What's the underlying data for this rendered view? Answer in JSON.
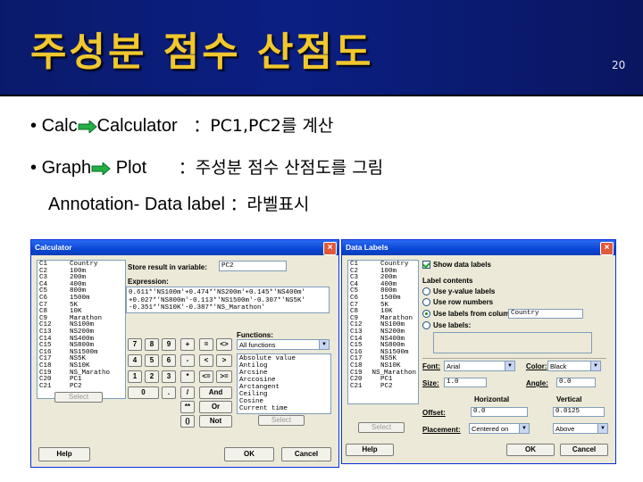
{
  "slide": {
    "title": "주성분 점수 산점도",
    "page_number": "20",
    "line1": {
      "bullet": "•",
      "a": "Calc",
      "b": "Calculator",
      "c": "：PC1,PC2를 계산"
    },
    "line2": {
      "bullet": "•",
      "a": "Graph",
      "b": "Plot",
      "c": "：주성분 점수 산점도를 그림"
    },
    "line3": {
      "a": "Annotation- Data label",
      "b": "：라벨표시"
    }
  },
  "calculator": {
    "title": "Calculator",
    "close": "×",
    "columns": [
      [
        "C1",
        "Country"
      ],
      [
        "C2",
        "100m"
      ],
      [
        "C3",
        "200m"
      ],
      [
        "C4",
        "400m"
      ],
      [
        "C5",
        "800m"
      ],
      [
        "C6",
        "1500m"
      ],
      [
        "C7",
        "5K"
      ],
      [
        "C8",
        "10K"
      ],
      [
        "C9",
        "Marathon"
      ],
      [
        "C12",
        "NS100m"
      ],
      [
        "C13",
        "NS200m"
      ],
      [
        "C14",
        "NS400m"
      ],
      [
        "C15",
        "NS800m"
      ],
      [
        "C16",
        "NS1500m"
      ],
      [
        "C17",
        "NS5K"
      ],
      [
        "C18",
        "NS10K"
      ],
      [
        "C19",
        "NS_Maratho"
      ],
      [
        "C20",
        "PC1"
      ],
      [
        "C21",
        "PC2"
      ]
    ],
    "store_label": "Store result in variable:",
    "store_value": "PC2",
    "expression_label": "Expression:",
    "expression_lines": [
      "0.611*'NS100m'+0.474*'NS200m'+0.145*'NS400m'",
      "+0.027*'NS800m'-0.113*'NS1500m'-0.307*'NS5K'",
      "-0.351*'NS10K'-0.387*'NS_Marathon'"
    ],
    "keypad": [
      [
        "7",
        "8",
        "9",
        "+",
        "=",
        "<>"
      ],
      [
        "4",
        "5",
        "6",
        "-",
        "<",
        ">"
      ],
      [
        "1",
        "2",
        "3",
        "*",
        "<=",
        ">="
      ],
      [
        "0",
        ".",
        "/",
        "And"
      ],
      [
        "**",
        "Or"
      ],
      [
        "()",
        "Not"
      ]
    ],
    "functions_label": "Functions:",
    "functions_select": "All functions",
    "functions": [
      "Absolute value",
      "Antilog",
      "Arcsine",
      "Arccosine",
      "Arctangent",
      "Ceiling",
      "Cosine",
      "Current time"
    ],
    "select_left": "Select",
    "select_right": "Select",
    "help": "Help",
    "ok": "OK",
    "cancel": "Cancel"
  },
  "data_labels": {
    "title": "Data Labels",
    "close": "×",
    "columns": [
      [
        "C1",
        "Country"
      ],
      [
        "C2",
        "100m"
      ],
      [
        "C3",
        "200m"
      ],
      [
        "C4",
        "400m"
      ],
      [
        "C5",
        "800m"
      ],
      [
        "C6",
        "1500m"
      ],
      [
        "C7",
        "5K"
      ],
      [
        "C8",
        "10K"
      ],
      [
        "C9",
        "Marathon"
      ],
      [
        "C12",
        "NS100m"
      ],
      [
        "C13",
        "NS200m"
      ],
      [
        "C14",
        "NS400m"
      ],
      [
        "C15",
        "NS800m"
      ],
      [
        "C16",
        "NS1500m"
      ],
      [
        "C17",
        "NS5K"
      ],
      [
        "C18",
        "NS10K"
      ],
      [
        "C19",
        "NS_Marathon"
      ],
      [
        "C20",
        "PC1"
      ],
      [
        "C21",
        "PC2"
      ]
    ],
    "show_labels": "Show data labels",
    "label_contents": "Label contents",
    "opt_yvalue": "Use y-value labels",
    "opt_rownum": "Use row numbers",
    "opt_column": "Use labels from column:",
    "column_value": "Country",
    "opt_use": "Use labels:",
    "font_label": "Font:",
    "font_value": "Arial",
    "color_label": "Color:",
    "color_value": "Black",
    "size_label": "Size:",
    "size_value": "1.0",
    "angle_label": "Angle:",
    "angle_value": "0.0",
    "horizontal": "Horizontal",
    "vertical": "Vertical",
    "offset_label": "Offset:",
    "offset_h": "0.0",
    "offset_v": "0.0125",
    "placement_label": "Placement:",
    "placement_h": "Centered on",
    "placement_v": "Above",
    "select": "Select",
    "help": "Help",
    "ok": "OK",
    "cancel": "Cancel"
  },
  "colors": {
    "header": "#0b1f83",
    "title": "#f0c72e",
    "arrow": "#23b045"
  }
}
